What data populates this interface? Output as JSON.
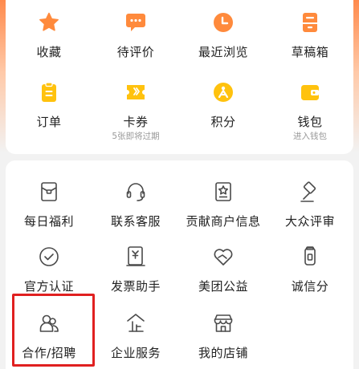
{
  "colors": {
    "orange": "#ff8a3c",
    "yellow": "#ffc20e",
    "outline": "#4a4a4a",
    "highlight": "#e02020"
  },
  "top_grid": [
    {
      "label": "收藏",
      "icon": "star-icon"
    },
    {
      "label": "待评价",
      "icon": "chat-bubble-icon"
    },
    {
      "label": "最近浏览",
      "icon": "clock-icon"
    },
    {
      "label": "草稿箱",
      "icon": "drafts-box-icon"
    },
    {
      "label": "订单",
      "icon": "order-clipboard-icon"
    },
    {
      "label": "卡券",
      "icon": "coupon-ticket-icon",
      "sublabel": "5张即将过期"
    },
    {
      "label": "积分",
      "icon": "points-medal-icon"
    },
    {
      "label": "钱包",
      "icon": "wallet-icon",
      "sublabel": "进入钱包"
    }
  ],
  "service_grid": [
    {
      "label": "每日福利",
      "icon": "envelope-icon"
    },
    {
      "label": "联系客服",
      "icon": "headset-icon"
    },
    {
      "label": "贡献商户信息",
      "icon": "storefront-star-icon"
    },
    {
      "label": "大众评审",
      "icon": "gavel-icon"
    },
    {
      "label": "官方认证",
      "icon": "verified-check-icon"
    },
    {
      "label": "发票助手",
      "icon": "invoice-icon"
    },
    {
      "label": "美团公益",
      "icon": "charity-heart-icon"
    },
    {
      "label": "诚信分",
      "icon": "credit-score-icon"
    },
    {
      "label": "合作/招聘",
      "icon": "people-icon"
    },
    {
      "label": "企业服务",
      "icon": "enterprise-icon"
    },
    {
      "label": "我的店铺",
      "icon": "my-shop-icon"
    }
  ]
}
